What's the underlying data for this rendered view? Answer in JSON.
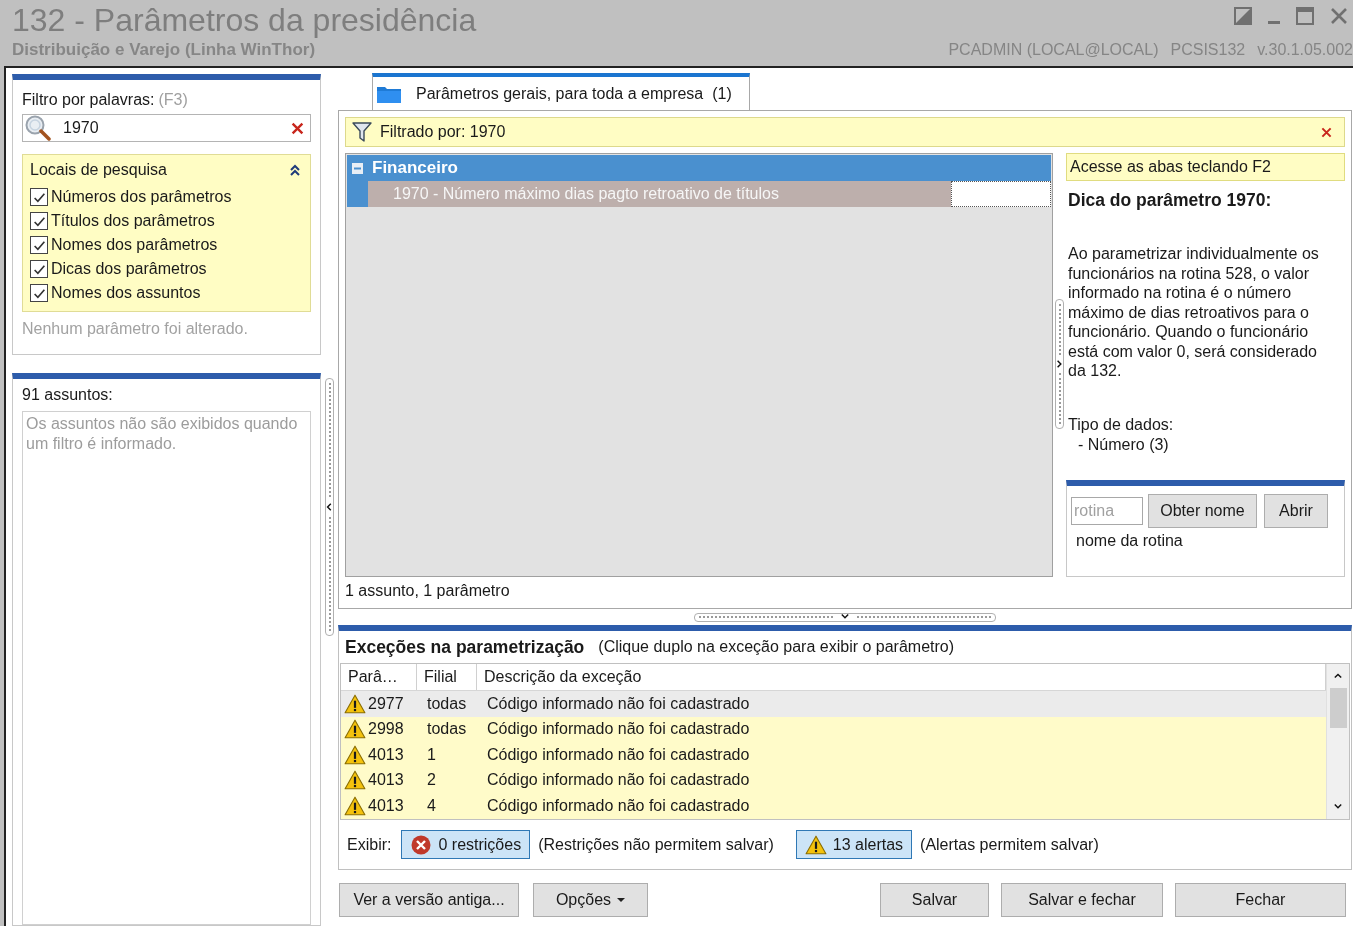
{
  "window": {
    "title": "132 - Parâmetros da presidência",
    "subtitle": "Distribuição e Varejo (Linha WinThor)",
    "user": "PCADMIN (LOCAL@LOCAL)",
    "program": "PCSIS132",
    "version": "v.30.1.05.002"
  },
  "filter_panel": {
    "label": "Filtro por palavras:",
    "shortcut": "(F3)",
    "search": {
      "value": "1970"
    },
    "search_locations": {
      "title": "Locais de pesquisa",
      "expanded": true,
      "options": [
        {
          "label": "Números dos parâmetros",
          "checked": true
        },
        {
          "label": "Títulos dos parâmetros",
          "checked": true
        },
        {
          "label": "Nomes dos parâmetros",
          "checked": true
        },
        {
          "label": "Dicas dos parâmetros",
          "checked": true
        },
        {
          "label": "Nomes dos assuntos",
          "checked": true
        }
      ]
    },
    "status": "Nenhum parâmetro foi alterado."
  },
  "subjects_panel": {
    "title": "91 assuntos:",
    "message": "Os assuntos não são exibidos quando um filtro é informado."
  },
  "tabs": [
    {
      "label": "Parâmetros gerais, para toda a empresa  (1)",
      "selected": true
    }
  ],
  "filter_bar": {
    "label": "Filtrado por: 1970"
  },
  "tree": [
    {
      "label": "Financeiro",
      "expanded": true,
      "children": [
        {
          "label": "1970 - Número máximo dias pagto retroativo de títulos",
          "selected": true
        }
      ]
    }
  ],
  "hint": {
    "banner": "Acesse as abas teclando F2",
    "title": "Dica do parâmetro 1970:",
    "text": "Ao parametrizar individualmente os funcionários na rotina 528, o valor informado na rotina é o número máximo de dias retroativos para o funcionário. Quando o funcionário está com valor 0, será considerado da 132.",
    "data_type_label": "Tipo de dados:",
    "data_type": "- Número (3)"
  },
  "routine": {
    "placeholder": "rotina",
    "buttons": [
      "Obter nome",
      "Abrir"
    ],
    "name": "nome da rotina"
  },
  "summary": "1 assunto, 1 parâmetro",
  "exceptions": {
    "title": "Exceções na parametrização",
    "note": "(Clique duplo na exceção para exibir o parâmetro)",
    "columns": [
      "Parâ…",
      "Filial",
      "Descrição da exceção"
    ],
    "rows": [
      {
        "kind": "alert",
        "param": "2977",
        "branch": "todas",
        "description": "Código informado não foi cadastrado",
        "selected": true
      },
      {
        "kind": "alert",
        "param": "2998",
        "branch": "todas",
        "description": "Código informado não foi cadastrado",
        "selected": false
      },
      {
        "kind": "alert",
        "param": "4013",
        "branch": "1",
        "description": "Código informado não foi cadastrado",
        "selected": false
      },
      {
        "kind": "alert",
        "param": "4013",
        "branch": "2",
        "description": "Código informado não foi cadastrado",
        "selected": false
      },
      {
        "kind": "alert",
        "param": "4013",
        "branch": "4",
        "description": "Código informado não foi cadastrado",
        "selected": false
      }
    ],
    "show_label": "Exibir:",
    "toggles": [
      {
        "kind": "restriction",
        "label": "0 restrições",
        "note": "(Restrições não permitem salvar)",
        "on": true
      },
      {
        "kind": "alert",
        "label": "13 alertas",
        "note": "(Alertas permitem salvar)",
        "on": true
      }
    ]
  },
  "left_buttons": [
    {
      "label": "Ver a versão antiga...",
      "kind": "plain"
    },
    {
      "label": "Opções",
      "kind": "menu"
    }
  ],
  "right_buttons": [
    {
      "label": "Salvar",
      "kind": "plain"
    },
    {
      "label": "Salvar e fechar",
      "kind": "plain"
    },
    {
      "label": "Fechar",
      "kind": "plain"
    }
  ]
}
